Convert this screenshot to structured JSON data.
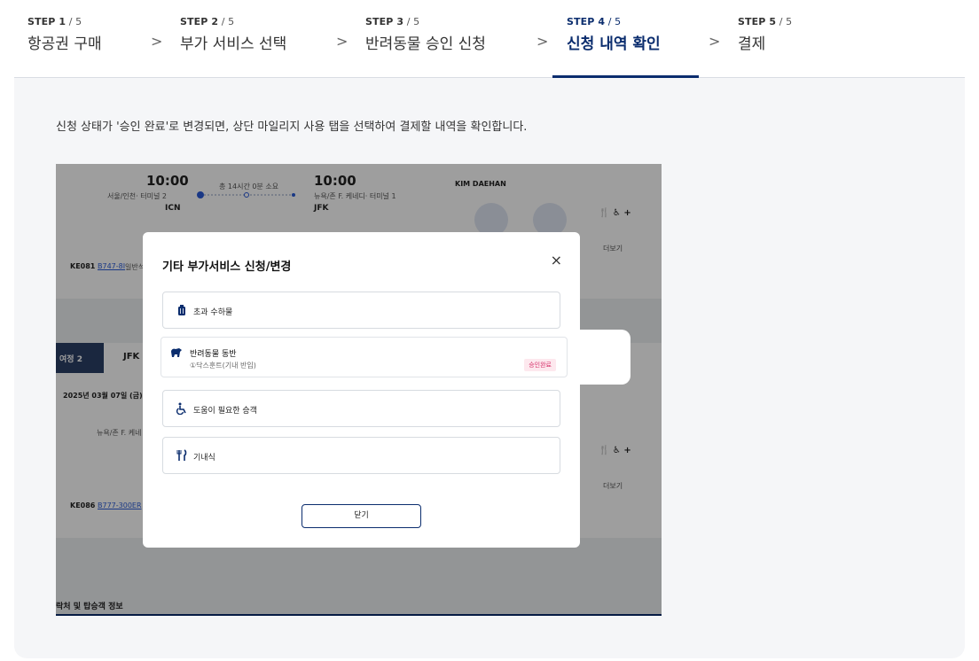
{
  "steps": [
    {
      "num": "STEP 1",
      "total": " / 5",
      "title": "항공권 구매"
    },
    {
      "num": "STEP 2",
      "total": " / 5",
      "title": "부가 서비스 선택"
    },
    {
      "num": "STEP 3",
      "total": " / 5",
      "title": "반려동물 승인 신청"
    },
    {
      "num": "STEP 4",
      "total": " / 5",
      "title": "신청 내역 확인"
    },
    {
      "num": "STEP 5",
      "total": " / 5",
      "title": "결제"
    }
  ],
  "chevron": ">",
  "description": "신청 상태가 '승인 완료'로 변경되면, 상단 마일리지 사용 탭을 선택하여 결제할 내역을 확인합니다.",
  "screenshot": {
    "flight1": {
      "dep_time": "10:00",
      "dep_place": "서울/인천· 터미널 2",
      "dep_code": "ICN",
      "duration": "총 14시간 0분 소요",
      "arr_time": "10:00",
      "arr_place": "뉴욕/존 F. 케네디· 터미널 1",
      "arr_code": "JFK",
      "passenger": "KIM DAEHAN",
      "more": "더보기",
      "flight_no": "KE081",
      "aircraft": "B747-8I",
      "cabin": "일반석"
    },
    "flight2": {
      "segment": "여정 2",
      "route": "JFK -",
      "date": "2025년 03월 07일 (금)",
      "place": "뉴욕/존 F. 케네",
      "flight_no": "KE086",
      "aircraft": "B777-300ER",
      "more": "더보기"
    },
    "footer_text": "락처 및 탑승객 정보",
    "modal": {
      "title": "기타 부가서비스 신청/변경",
      "close_icon": "×",
      "options": [
        {
          "label": "초과 수하물",
          "icon": "luggage-icon"
        },
        {
          "label": "반려동물 동반",
          "sub": "①닥스훈트(기내 반입)",
          "badge": "승인완료",
          "icon": "pet-icon"
        },
        {
          "label": "도움이 필요한 승객",
          "icon": "wheelchair-icon"
        },
        {
          "label": "기내식",
          "icon": "meal-icon"
        }
      ],
      "close_button": "닫기"
    }
  },
  "colors": {
    "primary": "#0b2d6e",
    "badge": "#d6336c",
    "panel": "#f5f6f8"
  }
}
